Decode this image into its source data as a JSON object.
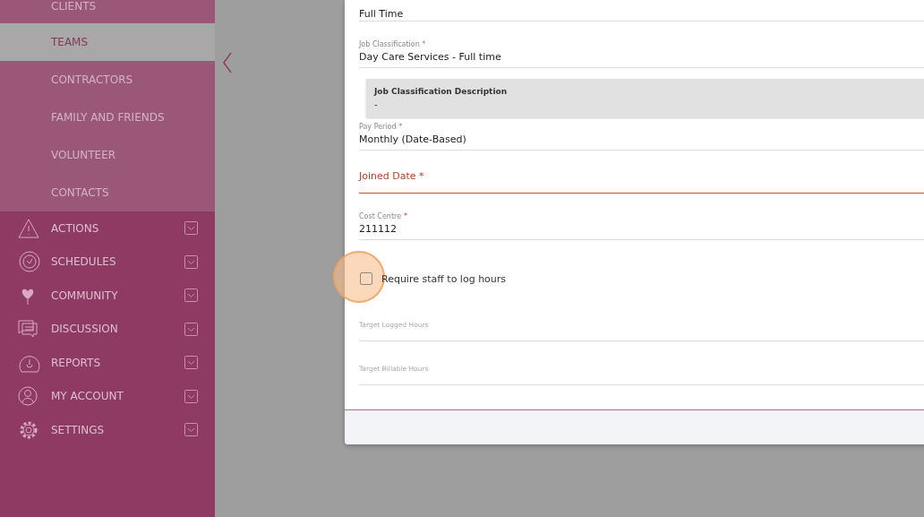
{
  "sidebar": {
    "submenu": [
      {
        "label": "CLIENTS",
        "selected": false
      },
      {
        "label": "TEAMS",
        "selected": true
      },
      {
        "label": "CONTRACTORS",
        "selected": false
      },
      {
        "label": "FAMILY AND FRIENDS",
        "selected": false
      },
      {
        "label": "VOLUNTEER",
        "selected": false
      },
      {
        "label": "CONTACTS",
        "selected": false
      }
    ],
    "items": [
      {
        "label": "ACTIONS",
        "kind": "warning",
        "expanded": false
      },
      {
        "label": "SCHEDULES",
        "kind": "clock",
        "expanded": false
      },
      {
        "label": "COMMUNITY",
        "kind": "heart",
        "expanded": false
      },
      {
        "label": "DISCUSSION",
        "kind": "chat",
        "expanded": false
      },
      {
        "label": "REPORTS",
        "kind": "gauge",
        "expanded": false
      },
      {
        "label": "MY ACCOUNT",
        "kind": "user",
        "expanded": false
      },
      {
        "label": "SETTINGS",
        "kind": "gear",
        "expanded": false
      }
    ]
  },
  "form": {
    "fields": [
      {
        "kind": "select",
        "value": "Full Time"
      },
      {
        "kind": "select",
        "label": "Job Classification *",
        "value": "Day Care Services - Full time"
      },
      {
        "kind": "info",
        "label": "Job Classification Description",
        "value": "-"
      },
      {
        "kind": "select",
        "label": "Pay Period *",
        "value": "Monthly (Date-Based)"
      },
      {
        "kind": "date",
        "label": "Joined Date *",
        "error": true
      },
      {
        "kind": "text",
        "label": "Cost Centre",
        "required_mark": "*",
        "value": "211112"
      },
      {
        "kind": "checkbox",
        "label": "Require staff to log hours",
        "checked": false,
        "highlighted": true
      },
      {
        "kind": "empty",
        "label": "Target Logged Hours"
      },
      {
        "kind": "empty",
        "label": "Target Billable Hours"
      }
    ]
  }
}
